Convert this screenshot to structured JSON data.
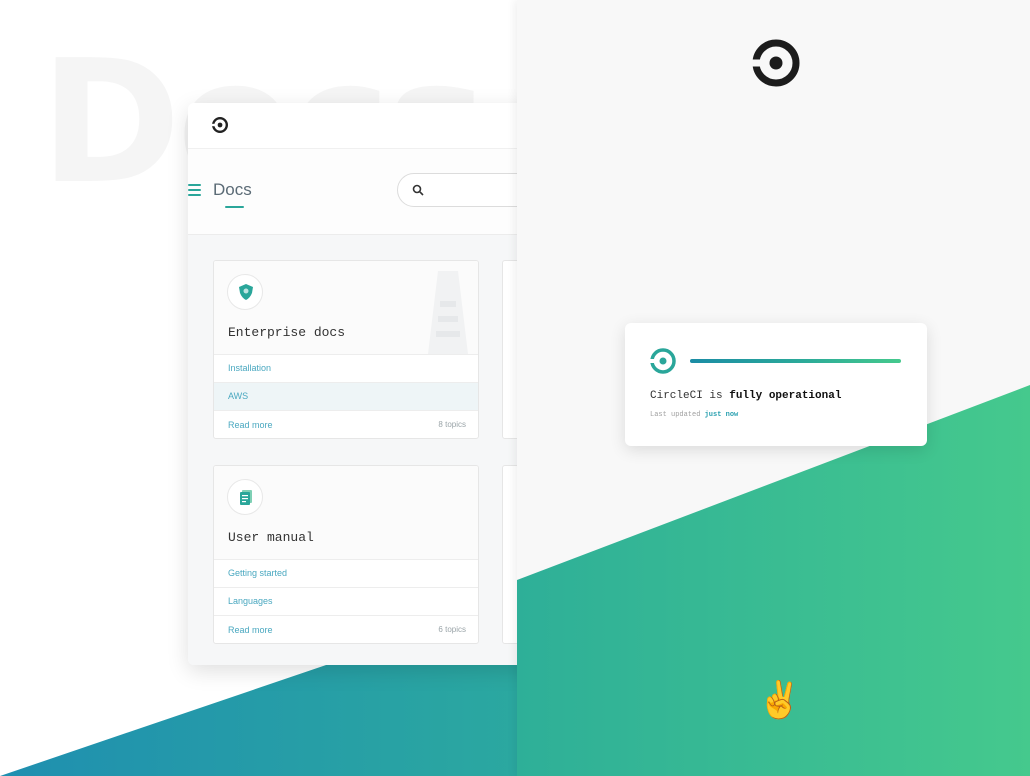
{
  "background_word": "Docs",
  "docs_window": {
    "nav_title": "Docs",
    "search_placeholder": "",
    "cards": [
      {
        "title": "Enterprise docs",
        "icon": "shield-icon",
        "links": [
          "Installation",
          "AWS"
        ],
        "read_more": "Read more",
        "topics": "8 topics"
      },
      {
        "title": "User manual",
        "icon": "document-icon",
        "links": [
          "Getting started",
          "Languages"
        ],
        "read_more": "Read more",
        "topics": "6 topics"
      }
    ]
  },
  "status": {
    "prefix": "CircleCI is ",
    "state": "fully operational",
    "updated_prefix": "Last updated ",
    "updated_link": "just now"
  },
  "emoji": "✌️",
  "colors": {
    "accent": "#2aa69a",
    "green": "#45c98d",
    "blue": "#1f8fb0",
    "link": "#4aa8c0"
  }
}
